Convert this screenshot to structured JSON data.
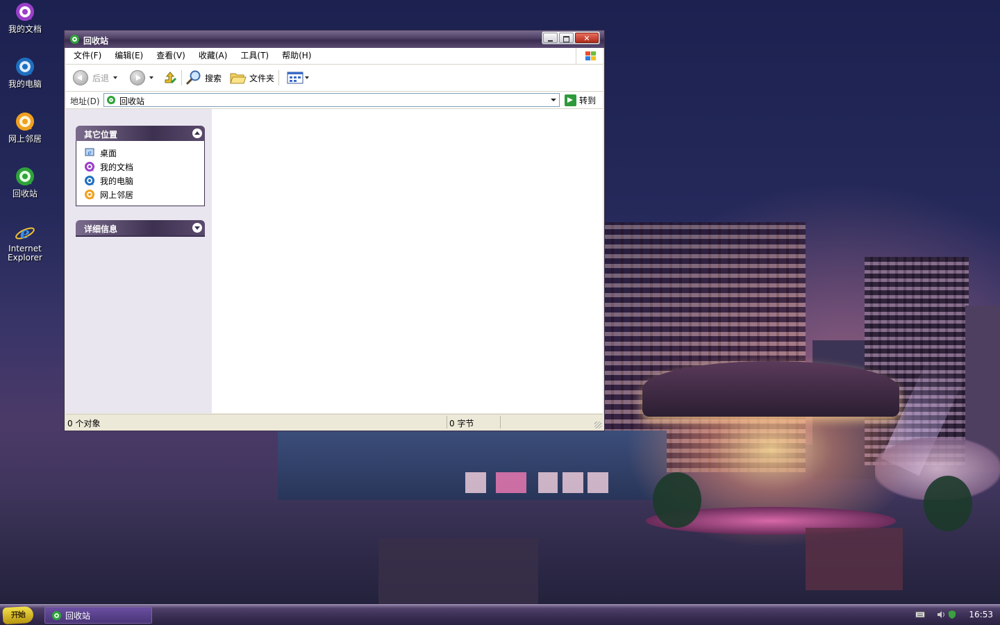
{
  "colors": {
    "accent": "#3d3150",
    "desktop": "#1d2246",
    "window_face": "#ece9d8",
    "recycle_green": "#2fa33a",
    "docs_purple": "#9a3fc8",
    "computer_blue": "#1f6fc0",
    "network_orange": "#f0a020"
  },
  "desktop": {
    "icons": [
      {
        "label": "我的文档",
        "icon": "my-documents-icon"
      },
      {
        "label": "我的电脑",
        "icon": "my-computer-icon"
      },
      {
        "label": "网上邻居",
        "icon": "network-places-icon"
      },
      {
        "label": "回收站",
        "icon": "recycle-bin-icon"
      },
      {
        "label_line1": "Internet",
        "label_line2": "Explorer",
        "icon": "internet-explorer-icon"
      }
    ]
  },
  "window": {
    "title": "回收站",
    "menu": [
      "文件(F)",
      "编辑(E)",
      "查看(V)",
      "收藏(A)",
      "工具(T)",
      "帮助(H)"
    ],
    "toolbar": {
      "back": "后退",
      "search": "搜索",
      "folders": "文件夹"
    },
    "address": {
      "label": "地址(D)",
      "value": "回收站",
      "go": "转到"
    },
    "taskpane": {
      "other_places": {
        "title": "其它位置",
        "items": [
          "桌面",
          "我的文档",
          "我的电脑",
          "网上邻居"
        ]
      },
      "details": {
        "title": "详细信息"
      }
    },
    "status": {
      "objects": "0 个对象",
      "size": "0 字节"
    }
  },
  "taskbar": {
    "start_label": "开始",
    "task_button": "回收站",
    "clock": "16:53"
  }
}
